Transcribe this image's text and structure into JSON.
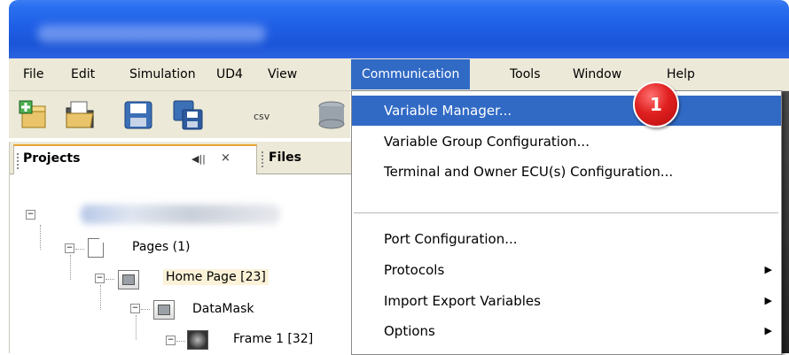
{
  "menubar": {
    "items": [
      "File",
      "Edit",
      "Simulation",
      "UD4",
      "View",
      "Communication",
      "Tools",
      "Window",
      "Help"
    ],
    "active": "Communication"
  },
  "toolbar": {
    "icons": [
      "new-project-icon",
      "open-folder-icon",
      "save-icon",
      "save-all-icon",
      "csv-icon",
      "database-icon"
    ],
    "csv_label": "csv"
  },
  "panel": {
    "tabs": {
      "projects": "Projects",
      "files": "Files",
      "minimize_glyph": "◀||",
      "close_glyph": "×"
    },
    "tree": [
      {
        "label": "",
        "blurred": true
      },
      {
        "label": "Pages (1)"
      },
      {
        "label": "Home Page [23]",
        "highlighted": true
      },
      {
        "label": "DataMask"
      },
      {
        "label": "Frame 1 [32]"
      }
    ]
  },
  "dropdown": {
    "items": [
      {
        "label": "Variable Manager...",
        "submenu": false,
        "active": true
      },
      {
        "label": "Variable Group Configuration...",
        "submenu": false
      },
      {
        "label": "Terminal and Owner ECU(s) Configuration...",
        "submenu": false
      },
      {
        "label": "Port Configuration...",
        "submenu": false
      },
      {
        "label": "Protocols",
        "submenu": true
      },
      {
        "label": "Import Export Variables",
        "submenu": true
      },
      {
        "label": "Options",
        "submenu": true
      }
    ],
    "submenu_glyph": "▶"
  },
  "badge": {
    "text": "1",
    "color": "#e02020"
  },
  "colors": {
    "menu_highlight": "#316ac5",
    "menubar_bg": "#ece9d8",
    "titlebar": "#1f5fe6"
  }
}
